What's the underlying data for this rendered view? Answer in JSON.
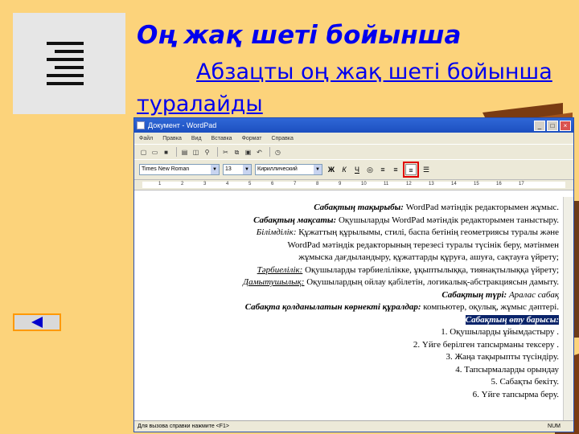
{
  "slide": {
    "title": "Оң жақ шеті бойынша",
    "subtitle": "Абзацты оң жақ  шеті бойынша туралайды",
    "align_icon": "align-right-icon",
    "back_icon": "left-arrow-icon"
  },
  "window": {
    "title": "Документ - WordPad",
    "menu": [
      "Файл",
      "Правка",
      "Вид",
      "Вставка",
      "Формат",
      "Справка"
    ],
    "font_name": "Times New Roman",
    "font_size": "13",
    "script": "Кириллический",
    "ruler_numbers": [
      "1",
      "2",
      "3",
      "4",
      "5",
      "6",
      "7",
      "8",
      "9",
      "10",
      "11",
      "12",
      "13",
      "14",
      "15",
      "16",
      "17"
    ],
    "status_left": "Для вызова справки нажмите <F1>",
    "status_right": "NUM"
  },
  "document": {
    "l1a": "Сабақтың тақырыбы:",
    "l1b": " WordPad мәтіндік редакторымен жұмыс.",
    "l2a": "Сабақтың мақсаты:",
    "l2b": " Оқушыларды WordPad мәтіндік редакторымен таныстыру.",
    "l3a": "Білімділік:",
    "l3b": "   Құжаттың құрылымы, стилі, баспа бетінің геометриясы туралы және",
    "l4": "WordPad мәтіндік редакторының терезесі туралы түсінік беру, мәтінмен",
    "l5": "жұмыска дағдыландыру, құжаттарды құруға, ашуға, сақтауға үйрету;",
    "l6a": "Тәрбиелілік:",
    "l6b": " Оқушыларды тәрбиелілікке, ұқыптылыққа, тиянақтылыққа үйрету;",
    "l7a": "Дамытушылық:",
    "l7b": " Оқушылардың ойлау қабілетін, логикалық-абстракциясын дамыту.",
    "l8a": "Сабақтың түрі:",
    "l8b": " Аралас сабақ",
    "l9a": "Сабақта қолданылатын көрнекті құралдар:",
    "l9b": " компьютер, оқулық, жұмыс дәптері.",
    "l10": "Сабақтың өту барысы:",
    "items": [
      "1.  Оқушыларды ұйымдастыру .",
      "2.    Үйге берілген тапсырманы тексеру .",
      "3. Жаңа тақырыпты түсіндіру.",
      "4.    Тапсырмаларды орындау",
      "5.    Сабақты бекіту.",
      "6.    Үйге тапсырма беру."
    ]
  },
  "colors": {
    "background": "#fcd37b",
    "title": "#0000ee",
    "highlight_box": "#e00000"
  }
}
